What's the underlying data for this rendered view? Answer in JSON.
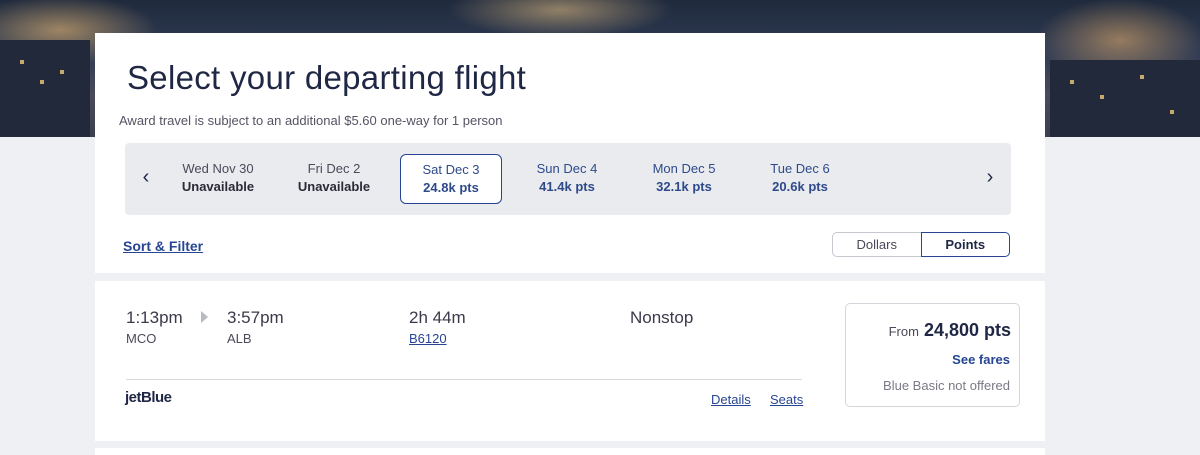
{
  "header": {
    "title": "Select your departing flight",
    "subtitle": "Award travel is subject to an additional $5.60 one-way for 1 person"
  },
  "date_bar": {
    "prev_icon": "chevron-left-icon",
    "next_icon": "chevron-right-icon",
    "dates": [
      {
        "date": "Wed Nov 30",
        "price": "Unavailable",
        "state": "unavailable"
      },
      {
        "date": "Fri Dec 2",
        "price": "Unavailable",
        "state": "unavailable"
      },
      {
        "date": "Sat Dec 3",
        "price": "24.8k pts",
        "state": "selected"
      },
      {
        "date": "Sun Dec 4",
        "price": "41.4k pts",
        "state": "available"
      },
      {
        "date": "Mon Dec 5",
        "price": "32.1k pts",
        "state": "available"
      },
      {
        "date": "Tue Dec 6",
        "price": "20.6k pts",
        "state": "available"
      }
    ]
  },
  "controls": {
    "sort_filter": "Sort & Filter",
    "currency_toggle": {
      "dollars": "Dollars",
      "points": "Points",
      "selected": "Points"
    }
  },
  "flight": {
    "depart_time": "1:13pm",
    "depart_code": "MCO",
    "arrive_time": "3:57pm",
    "arrive_code": "ALB",
    "duration": "2h 44m",
    "flight_number": "B6120",
    "stops": "Nonstop",
    "airline": "jetBlue",
    "details_link": "Details",
    "seats_link": "Seats",
    "fare": {
      "from_label": "From",
      "amount": "24,800 pts",
      "see_fares": "See fares",
      "note": "Blue Basic not offered"
    }
  },
  "colors": {
    "brand_navy": "#1f2745",
    "link_blue": "#274592",
    "page_bg": "#eff0f3"
  }
}
